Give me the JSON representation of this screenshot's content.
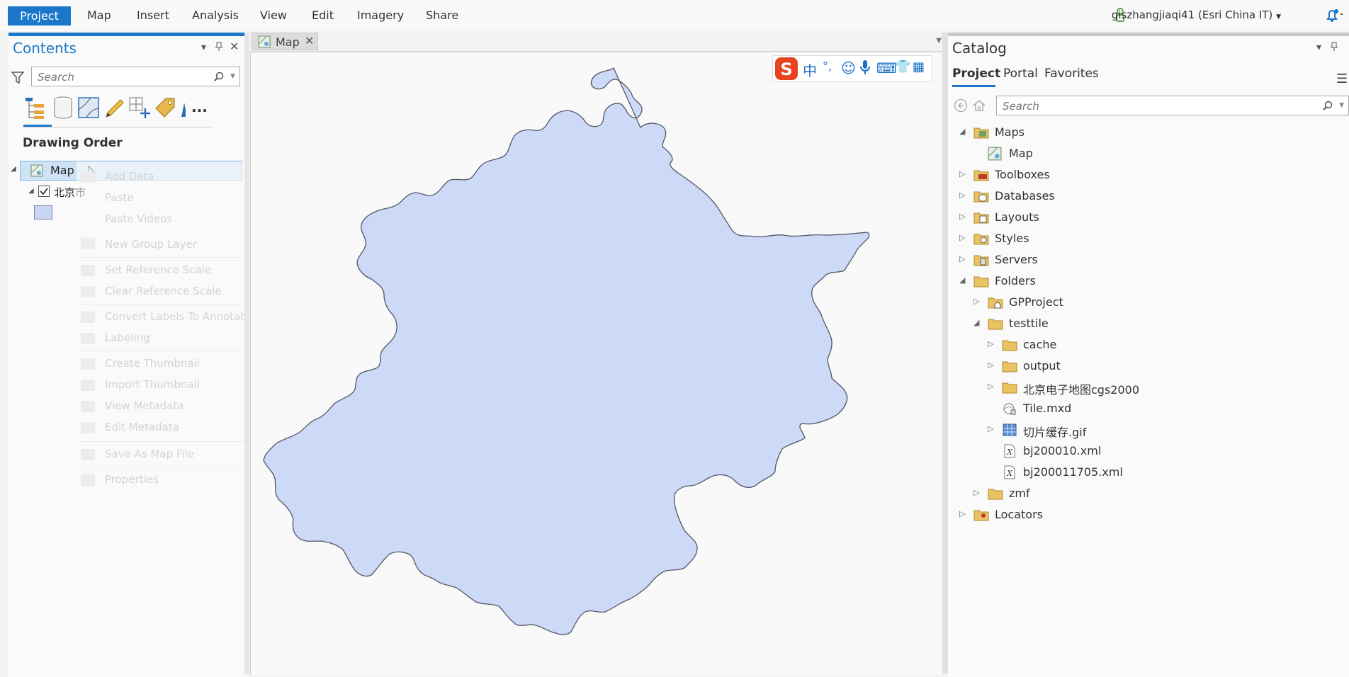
{
  "ribbon": {
    "tabs": [
      "Project",
      "Map",
      "Insert",
      "Analysis",
      "View",
      "Edit",
      "Imagery",
      "Share"
    ],
    "user": "giszhangjiaqi41 (Esri China IT)"
  },
  "contents": {
    "title": "Contents",
    "search_placeholder": "Search",
    "section": "Drawing Order",
    "map_item": "Map",
    "layer": "北京市",
    "more": "..."
  },
  "context_menu": {
    "items": [
      "Add Data",
      "Paste",
      "Paste Videos",
      "New Group Layer",
      "Set Reference Scale",
      "Clear Reference Scale",
      "Convert Labels To Annotation...",
      "Labeling",
      "Create Thumbnail",
      "Import Thumbnail",
      "View Metadata",
      "Edit Metadata",
      "Save As Map File",
      "Properties"
    ]
  },
  "map_view": {
    "tab_label": "Map",
    "ime": [
      "中",
      "°,",
      "☺",
      "🎤",
      "⌨",
      "👥",
      "👕",
      "▦"
    ],
    "polygon_fill": "#ccd9f7",
    "polygon_stroke": "#555566"
  },
  "catalog": {
    "title": "Catalog",
    "tabs": [
      "Project",
      "Portal",
      "Favorites"
    ],
    "search_placeholder": "Search",
    "tree": [
      {
        "label": "Maps",
        "icon": "maps-folder-icon"
      },
      {
        "label": "Map",
        "icon": "map-icon"
      },
      {
        "label": "Toolboxes",
        "icon": "toolboxes-folder-icon"
      },
      {
        "label": "Databases",
        "icon": "databases-folder-icon"
      },
      {
        "label": "Layouts",
        "icon": "layouts-folder-icon"
      },
      {
        "label": "Styles",
        "icon": "styles-folder-icon"
      },
      {
        "label": "Servers",
        "icon": "servers-folder-icon"
      },
      {
        "label": "Folders",
        "icon": "folders-icon"
      },
      {
        "label": "GPProject",
        "icon": "home-folder-icon"
      },
      {
        "label": "testtile",
        "icon": "folder-icon"
      },
      {
        "label": "cache",
        "icon": "folder-icon"
      },
      {
        "label": "output",
        "icon": "folder-icon"
      },
      {
        "label": "北京电子地图cgs2000",
        "icon": "folder-icon"
      },
      {
        "label": "Tile.mxd",
        "icon": "mxd-file-icon"
      },
      {
        "label": "切片缓存.gif",
        "icon": "raster-file-icon"
      },
      {
        "label": "bj200010.xml",
        "icon": "xml-file-icon"
      },
      {
        "label": "bj200011705.xml",
        "icon": "xml-file-icon"
      },
      {
        "label": "zmf",
        "icon": "folder-icon"
      },
      {
        "label": "Locators",
        "icon": "locators-folder-icon"
      }
    ]
  }
}
